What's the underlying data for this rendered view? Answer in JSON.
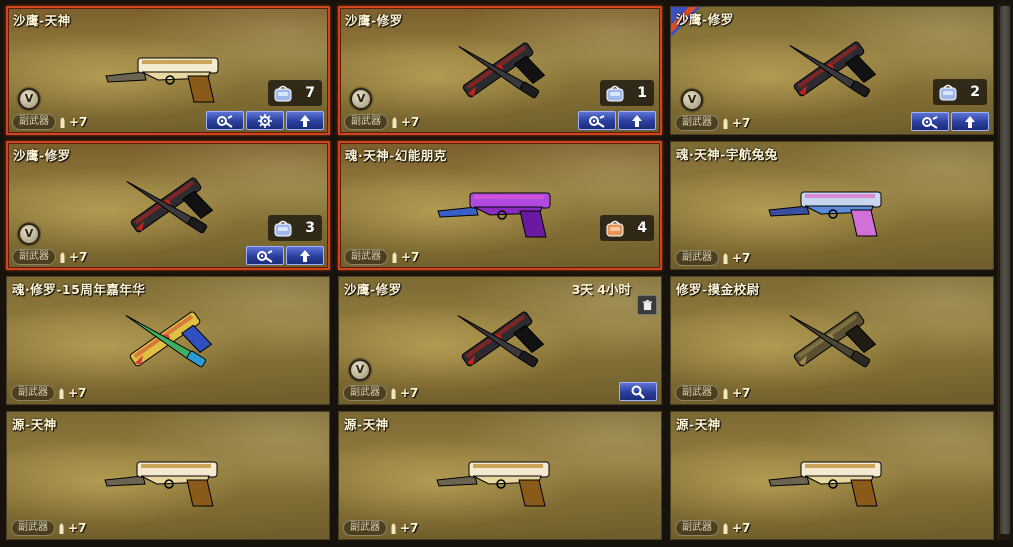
{
  "colors": {
    "selected_border": "#d0451c",
    "button_blue": "#2a3f9e",
    "name_text": "#fff6d6"
  },
  "cards": [
    {
      "name": "沙鹰-天神",
      "tag": "副武器",
      "level": "+7",
      "selected": true,
      "badge": "V",
      "count": "7",
      "pack": "blue",
      "buttons": [
        "wrench-gear-icon",
        "gear-icon",
        "up-arrow-icon"
      ],
      "gun": "gold",
      "corner": false,
      "timer": ""
    },
    {
      "name": "沙鹰-修罗",
      "tag": "副武器",
      "level": "+7",
      "selected": true,
      "badge": "V",
      "count": "1",
      "pack": "blue",
      "buttons": [
        "wrench-gear-icon",
        "up-arrow-icon"
      ],
      "gun": "black",
      "corner": false,
      "timer": ""
    },
    {
      "name": "沙鹰-修罗",
      "tag": "副武器",
      "level": "+7",
      "selected": false,
      "badge": "V",
      "count": "2",
      "pack": "blue",
      "buttons": [
        "wrench-gear-icon",
        "up-arrow-icon"
      ],
      "gun": "black",
      "corner": true,
      "timer": ""
    },
    {
      "name": "沙鹰-修罗",
      "tag": "副武器",
      "level": "+7",
      "selected": true,
      "badge": "V",
      "count": "3",
      "pack": "blue",
      "buttons": [
        "wrench-gear-icon",
        "up-arrow-icon"
      ],
      "gun": "black",
      "corner": false,
      "timer": ""
    },
    {
      "name": "魂·天神-幻能朋克",
      "tag": "副武器",
      "level": "+7",
      "selected": true,
      "badge": "",
      "count": "4",
      "pack": "orange",
      "buttons": [],
      "gun": "purple",
      "corner": false,
      "timer": ""
    },
    {
      "name": "魂·天神-宇航兔兔",
      "tag": "副武器",
      "level": "+7",
      "selected": false,
      "badge": "",
      "count": "",
      "pack": "",
      "buttons": [],
      "gun": "pinkblue",
      "corner": false,
      "timer": ""
    },
    {
      "name": "魂·修罗-15周年嘉年华",
      "tag": "副武器",
      "level": "+7",
      "selected": false,
      "badge": "",
      "count": "",
      "pack": "",
      "buttons": [],
      "gun": "rainbow",
      "corner": false,
      "timer": ""
    },
    {
      "name": "沙鹰-修罗",
      "tag": "副武器",
      "level": "+7",
      "selected": false,
      "badge": "V",
      "count": "",
      "pack": "",
      "buttons": [
        "search-icon"
      ],
      "gun": "black",
      "corner": false,
      "timer": "3天 4小时",
      "trash": true
    },
    {
      "name": "修罗-摸金校尉",
      "tag": "副武器",
      "level": "+7",
      "selected": false,
      "badge": "",
      "count": "",
      "pack": "",
      "buttons": [],
      "gun": "bronze",
      "corner": false,
      "timer": ""
    },
    {
      "name": "源-天神",
      "tag": "副武器",
      "level": "+7",
      "selected": false,
      "badge": "",
      "count": "",
      "pack": "",
      "buttons": [],
      "gun": "gold",
      "corner": false,
      "timer": ""
    },
    {
      "name": "源-天神",
      "tag": "副武器",
      "level": "+7",
      "selected": false,
      "badge": "",
      "count": "",
      "pack": "",
      "buttons": [],
      "gun": "gold",
      "corner": false,
      "timer": ""
    },
    {
      "name": "源-天神",
      "tag": "副武器",
      "level": "+7",
      "selected": false,
      "badge": "",
      "count": "",
      "pack": "",
      "buttons": [],
      "gun": "gold",
      "corner": false,
      "timer": ""
    }
  ]
}
